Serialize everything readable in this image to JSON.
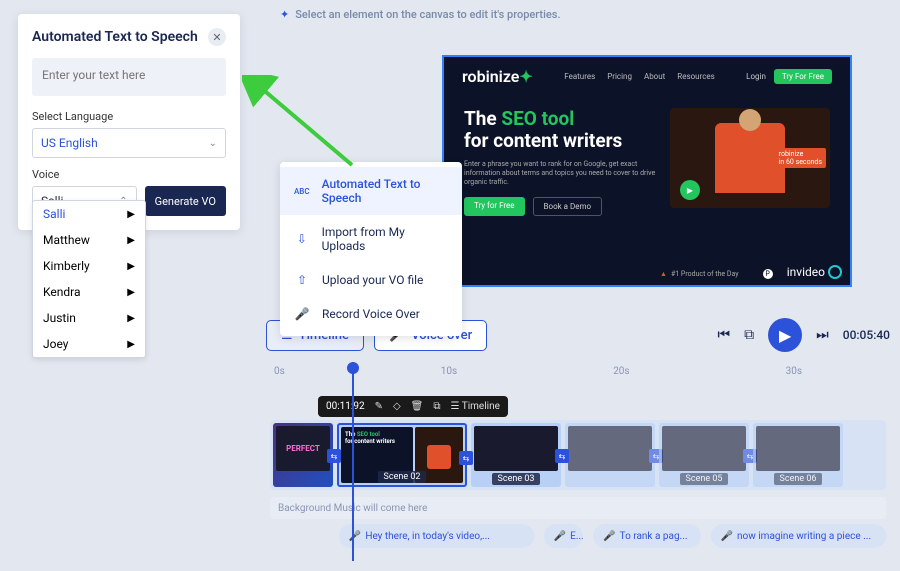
{
  "tts": {
    "title": "Automated Text to Speech",
    "placeholder": "Enter your text here",
    "lang_label": "Select Language",
    "lang_value": "US English",
    "voice_label": "Voice",
    "voice_value": "Salli",
    "generate": "Generate VO",
    "voices": [
      "Salli",
      "Matthew",
      "Kimberly",
      "Kendra",
      "Justin",
      "Joey"
    ]
  },
  "canvas_hint": "Select an element on the canvas to edit it's properties.",
  "vo_menu": {
    "item1": "Automated Text to Speech",
    "item2": "Import from My Uploads",
    "item3": "Upload your VO file",
    "item4": "Record Voice Over"
  },
  "preview": {
    "logo": "robinize",
    "nav1": "Features",
    "nav2": "Pricing",
    "nav3": "About",
    "nav4": "Resources",
    "login": "Login",
    "try": "Try For Free",
    "h_a": "The ",
    "h_b": "SEO tool",
    "h_c": "for content writers",
    "sub": "Enter a phrase you want to rank for on Google, get exact information about terms and topics you need to cover to drive organic traffic.",
    "cta1": "Try for Free",
    "cta2": "Book a Demo",
    "tag_a": "robinize",
    "tag_b": "in 60 seconds",
    "hunt": "#1 Product of the Day",
    "invideo": "invideo"
  },
  "controls": {
    "timeline": "Timeline",
    "voiceover": "Voice over",
    "time": "00:05:40"
  },
  "ruler": {
    "t0": "0s",
    "t1": "10s",
    "t2": "20s",
    "t3": "30s"
  },
  "clip_toolbar": {
    "time": "00:11:92",
    "timeline": "Timeline"
  },
  "clips": {
    "c2": "Scene 02",
    "c3": "Scene 03",
    "c4": "",
    "c5": "Scene 05",
    "c6": "Scene 06",
    "thumb_a": "The ",
    "thumb_b": "SEO tool",
    "thumb_c": "for content writers"
  },
  "music": "Background Music will come here",
  "vo_clips": {
    "v1": "Hey there, in today's video,...",
    "v2": "E...",
    "v3": "To rank a pag...",
    "v4": "now imagine writing a piece ..."
  }
}
